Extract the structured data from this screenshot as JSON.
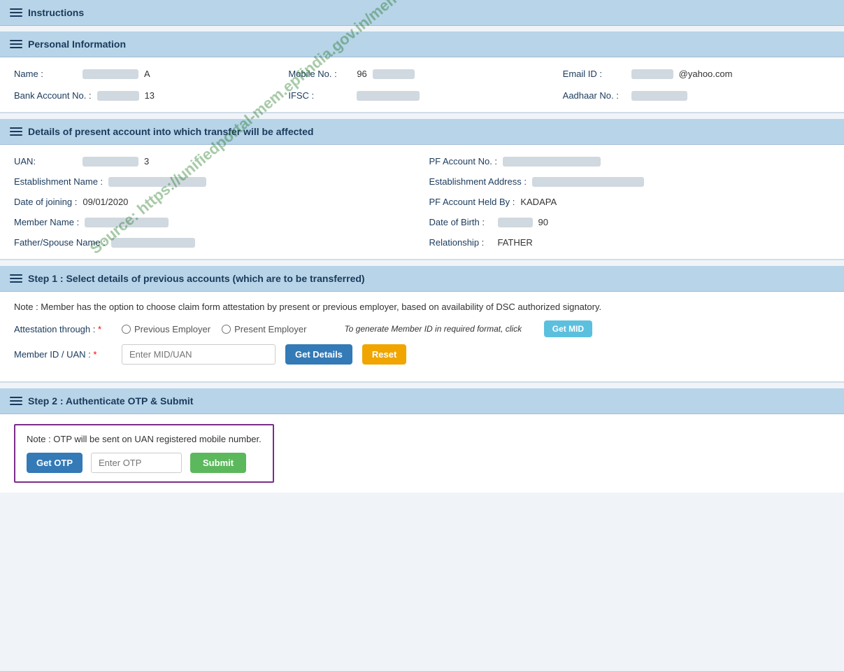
{
  "header": {
    "title": "Instructions",
    "hamburger_label": "menu"
  },
  "personal_info": {
    "section_title": "Personal Information",
    "name_label": "Name :",
    "name_value": "A",
    "mobile_label": "Mobile No. :",
    "mobile_value": "96",
    "email_label": "Email ID :",
    "email_value": "@yahoo.com",
    "bank_label": "Bank Account No. :",
    "bank_value": "13",
    "ifsc_label": "IFSC :",
    "aadhaar_label": "Aadhaar No. :"
  },
  "present_account": {
    "section_title": "Details of present account into which transfer will be affected",
    "uan_label": "UAN:",
    "uan_value": "3",
    "pf_account_label": "PF Account No. :",
    "establishment_name_label": "Establishment Name :",
    "establishment_address_label": "Establishment Address :",
    "doj_label": "Date of joining :",
    "doj_value": "09/01/2020",
    "pf_held_label": "PF Account Held By :",
    "pf_held_value": "KADAPA",
    "member_name_label": "Member Name :",
    "dob_label": "Date of Birth :",
    "dob_value": "90",
    "father_label": "Father/Spouse Name :",
    "relationship_label": "Relationship :",
    "relationship_value": "FATHER"
  },
  "step1": {
    "section_title": "Step 1 : Select details of previous accounts (which are to be transferred)",
    "note": "Note : Member has the option to choose claim form attestation by present or previous employer, based on availability of DSC authorized signatory.",
    "link_text": "availability of DSC authorized signatory",
    "attestation_label": "Attestation through :",
    "prev_employer_label": "Previous Employer",
    "present_employer_label": "Present Employer",
    "generate_label": "To generate Member ID in required format, click",
    "get_mid_label": "Get MID",
    "member_id_label": "Member ID / UAN :",
    "mid_placeholder": "Enter MID/UAN",
    "get_details_label": "Get Details",
    "reset_label": "Reset"
  },
  "step2": {
    "section_title": "Step 2 : Authenticate OTP & Submit",
    "note": "Note : OTP will be sent on UAN registered mobile number.",
    "get_otp_label": "Get OTP",
    "otp_placeholder": "Enter OTP",
    "submit_label": "Submit"
  },
  "watermark": "Source: https://unifiedportal-mem.epfindia.gov.in/memberinterface/"
}
